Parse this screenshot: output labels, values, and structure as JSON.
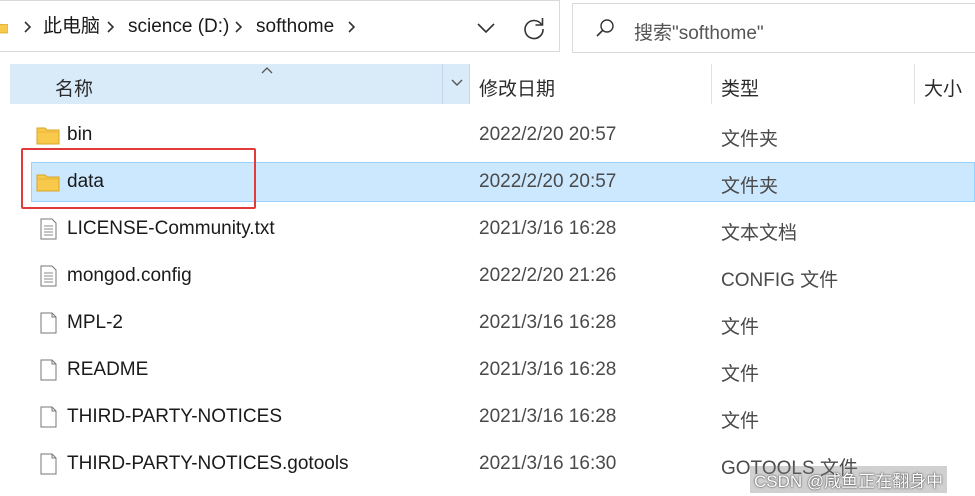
{
  "address_bar": {
    "breadcrumbs": [
      "此电脑",
      "science (D:)",
      "softhome"
    ]
  },
  "search": {
    "placeholder": "搜索\"softhome\""
  },
  "columns": {
    "name": "名称",
    "date": "修改日期",
    "type": "类型",
    "size": "大小"
  },
  "files": [
    {
      "name": "bin",
      "date": "2022/2/20 20:57",
      "type": "文件夹",
      "icon": "folder-icon"
    },
    {
      "name": "data",
      "date": "2022/2/20 20:57",
      "type": "文件夹",
      "icon": "folder-icon",
      "selected": true
    },
    {
      "name": "LICENSE-Community.txt",
      "date": "2021/3/16 16:28",
      "type": "文本文档",
      "icon": "text-file-icon"
    },
    {
      "name": "mongod.config",
      "date": "2022/2/20 21:26",
      "type": "CONFIG 文件",
      "icon": "config-file-icon"
    },
    {
      "name": "MPL-2",
      "date": "2021/3/16 16:28",
      "type": "文件",
      "icon": "file-icon"
    },
    {
      "name": "README",
      "date": "2021/3/16 16:28",
      "type": "文件",
      "icon": "file-icon"
    },
    {
      "name": "THIRD-PARTY-NOTICES",
      "date": "2021/3/16 16:28",
      "type": "文件",
      "icon": "file-icon"
    },
    {
      "name": "THIRD-PARTY-NOTICES.gotools",
      "date": "2021/3/16 16:30",
      "type": "GOTOOLS 文件",
      "icon": "file-icon"
    }
  ],
  "watermark": "CSDN @咸鱼正在翻身中",
  "colors": {
    "selection_bg": "#cce8ff",
    "selection_border": "#99d1ff",
    "header_active_bg": "#d9eaf8",
    "highlight_box": "#e23b3b",
    "folder": "#f8c94a"
  }
}
